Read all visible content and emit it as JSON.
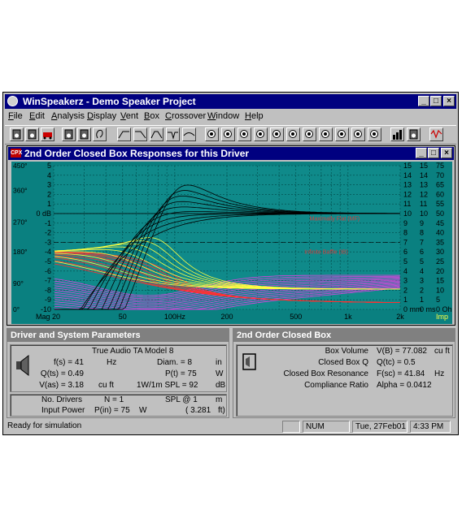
{
  "window": {
    "title": "WinSpeakerz - Demo Speaker Project"
  },
  "menu": [
    {
      "label": "File"
    },
    {
      "label": "Edit"
    },
    {
      "label": "Analysis"
    },
    {
      "label": "Display"
    },
    {
      "label": "Vent"
    },
    {
      "label": "Box"
    },
    {
      "label": "Crossover"
    },
    {
      "label": "Window"
    },
    {
      "label": "Help"
    }
  ],
  "toolbar": {
    "icons": [
      "driver-icon",
      "enclosure-icon",
      "car-icon",
      "speaker-array-icon",
      "speaker-pair-icon",
      "ear-icon",
      "highpass-filter-icon",
      "lowpass-filter-icon",
      "bandpass-filter-icon",
      "notch-filter-icon",
      "allpass-filter-icon",
      "response-1-icon",
      "response-2-icon",
      "response-3-icon",
      "response-4-icon",
      "response-5-icon",
      "response-6-icon",
      "response-7-icon",
      "response-8-icon",
      "response-9-icon",
      "response-10-icon",
      "response-11-icon",
      "bar-graph-icon",
      "calculator-icon",
      "signal-icon"
    ]
  },
  "graph_window": {
    "title": "2nd Order Closed Box Responses for this Driver",
    "icon_text": "CPX"
  },
  "chart_data": {
    "type": "line",
    "x_scale": "log",
    "x_range": [
      20,
      2000
    ],
    "x_ticks": [
      "Mag 20",
      "50",
      "100Hz",
      "200",
      "500",
      "1k",
      "2k"
    ],
    "left_axis_phase": [
      "450°",
      "360°",
      "270°",
      "180°",
      "90°",
      "0°"
    ],
    "left_axis_db": [
      "5",
      "4",
      "3",
      "2",
      "1",
      "0 dB",
      "-1",
      "-2",
      "-3",
      "-4",
      "-5",
      "-6",
      "-7",
      "-8",
      "-9",
      "-10"
    ],
    "right_axis_1": [
      "15",
      "14",
      "13",
      "12",
      "11",
      "10",
      "9",
      "8",
      "7",
      "6",
      "5",
      "4",
      "3",
      "2",
      "1",
      "0 mm"
    ],
    "right_axis_2": [
      "15",
      "14",
      "13",
      "12",
      "11",
      "10",
      "9",
      "8",
      "7",
      "6",
      "5",
      "4",
      "3",
      "2",
      "1",
      "0 ms"
    ],
    "right_axis_3": [
      "75",
      "70",
      "65",
      "60",
      "55",
      "50",
      "45",
      "40",
      "35",
      "30",
      "25",
      "20",
      "15",
      "10",
      "5",
      "0 Ohm"
    ],
    "imp_label": "Imp",
    "annotations": [
      "Maximally Flat (MF)",
      "Infinite Baffle (IB)"
    ],
    "colors": {
      "background": "#0f8a8a",
      "grid": "#004848",
      "magnitude": "#000000",
      "phase": "#ff3030",
      "excursion": "#ffff40",
      "group_delay": "#e040e0"
    },
    "series": [
      {
        "values_db_at_500Hz": [
          -0.2,
          -0.15,
          -0.1,
          -0.05,
          0,
          0.05,
          0.1
        ]
      }
    ]
  },
  "driver_panel": {
    "title": "Driver and System Parameters",
    "model": "True Audio  TA Model 8",
    "rows": [
      {
        "l1": "f(s) = 41",
        "u1": "Hz",
        "l2": "Diam. = 8",
        "u2": "in"
      },
      {
        "l1": "Q(ts) = 0.49",
        "u1": "",
        "l2": "P(t) = 75",
        "u2": "W"
      },
      {
        "l1": "V(as) = 3.18",
        "u1": "cu ft",
        "l2": "1W/1m SPL = 92",
        "u2": "dB"
      }
    ],
    "bottom": {
      "a1": "No. Drivers",
      "a2": "N = 1",
      "a3": "SPL @ 1",
      "a4": "m",
      "b1": "Input Power",
      "b2": "P(in) = 75",
      "b3": "W",
      "b4": "( 3.281",
      "b5": "ft)"
    }
  },
  "box_panel": {
    "title": "2nd Order Closed Box",
    "rows": [
      {
        "label": "Box Volume",
        "value": "V(B) = 77.082",
        "unit": "cu ft"
      },
      {
        "label": "Closed Box Q",
        "value": "Q(tc) = 0.5",
        "unit": ""
      },
      {
        "label": "Closed Box Resonance",
        "value": "F(sc) = 41.84",
        "unit": "Hz"
      },
      {
        "label": "Compliance Ratio",
        "value": "Alpha = 0.0412",
        "unit": ""
      }
    ]
  },
  "status": {
    "message": "Ready for simulation",
    "num": "NUM",
    "date": "Tue, 27Feb01",
    "time": "4:33 PM"
  }
}
